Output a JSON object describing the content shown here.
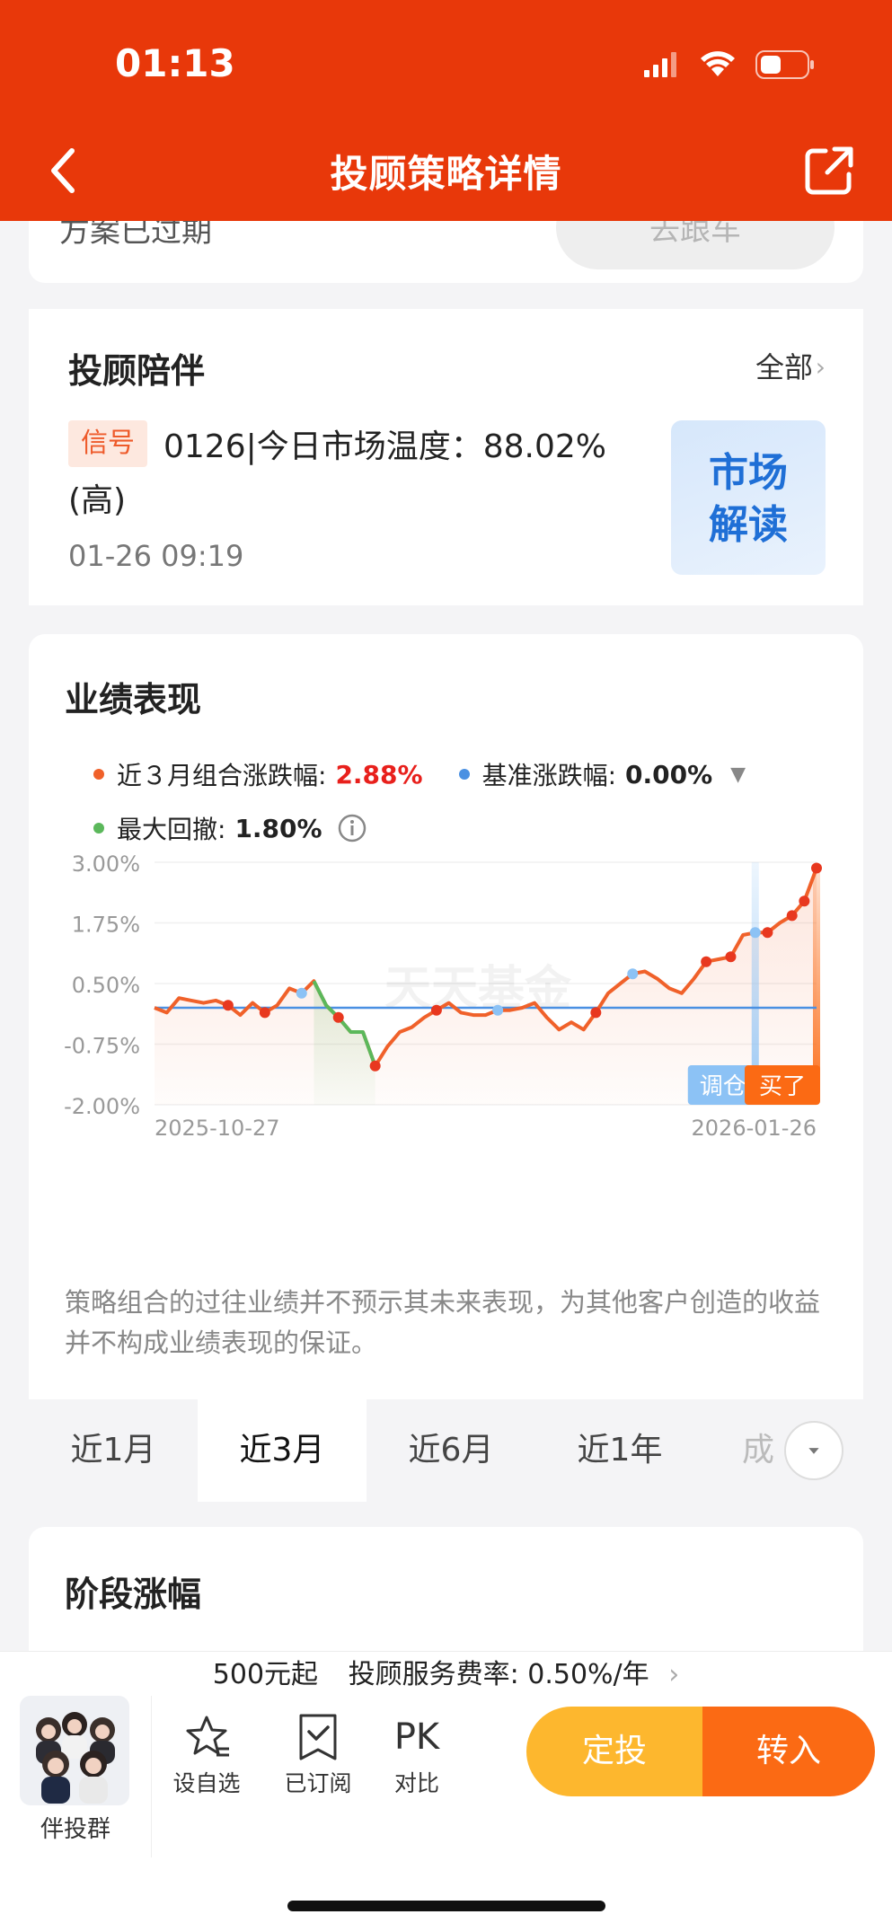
{
  "status_bar": {
    "time": "01:13"
  },
  "nav": {
    "title": "投顾策略详情"
  },
  "expired": {
    "text": "方案已过期",
    "follow_button": "去跟车"
  },
  "advisor": {
    "title": "投顾陪伴",
    "all_link": "全部",
    "signal_tag": "信号",
    "signal_text": "0126|今日市场温度：88.02%(高)",
    "signal_time": "01-26 09:19",
    "market_tile_line1": "市场",
    "market_tile_line2": "解读"
  },
  "performance": {
    "title": "业绩表现",
    "legend_portfolio_label": "近３月组合涨跌幅:",
    "legend_portfolio_value": "2.88%",
    "legend_benchmark_label": "基准涨跌幅:",
    "legend_benchmark_value": "0.00%",
    "legend_drawdown_label": "最大回撤:",
    "legend_drawdown_value": "1.80%",
    "watermark": "天天基金",
    "tag_adjust": "调仓",
    "tag_buy": "买了",
    "disclaimer": "策略组合的过往业绩并不预示其未来表现，为其他客户创造的收益并不构成业绩表现的保证。",
    "colors": {
      "portfolio": "#f0612a",
      "benchmark": "#4a90e2",
      "drawdown": "#5bb85b",
      "positive": "#e8201c"
    }
  },
  "chart_data": {
    "type": "line",
    "x_start": "2025-10-27",
    "x_end": "2026-01-26",
    "ylim": [
      -2.0,
      3.0
    ],
    "yticks": [
      "3.00%",
      "1.75%",
      "0.50%",
      "-0.75%",
      "-2.00%"
    ],
    "xticks": [
      "2025-10-27",
      "2026-01-26"
    ],
    "series": [
      {
        "values": [
          0.0,
          -0.1,
          0.2,
          0.15,
          0.1,
          0.15,
          0.05,
          -0.15,
          0.1,
          -0.1,
          0.05,
          0.4,
          0.3,
          0.55,
          0.05,
          -0.2,
          -0.5,
          -0.5,
          -1.2,
          -0.8,
          -0.5,
          -0.4,
          -0.2,
          -0.05,
          0.1,
          -0.1,
          -0.15,
          -0.15,
          -0.05,
          -0.05,
          0.0,
          0.1,
          -0.2,
          -0.45,
          -0.3,
          -0.45,
          -0.1,
          0.3,
          0.5,
          0.7,
          0.75,
          0.6,
          0.4,
          0.3,
          0.6,
          0.95,
          1.0,
          1.05,
          1.5,
          1.55,
          1.55,
          1.75,
          1.9,
          2.2,
          2.88
        ]
      },
      {
        "values": [
          0.0,
          0.0,
          0.0,
          0.0,
          0.0,
          0.0,
          0.0,
          0.0,
          0.0,
          0.0,
          0.0,
          0.0,
          0.0,
          0.0,
          0.0,
          0.0,
          0.0,
          0.0,
          0.0,
          0.0,
          0.0,
          0.0,
          0.0,
          0.0,
          0.0,
          0.0,
          0.0,
          0.0,
          0.0,
          0.0,
          0.0,
          0.0,
          0.0,
          0.0,
          0.0,
          0.0,
          0.0,
          0.0,
          0.0,
          0.0,
          0.0,
          0.0,
          0.0,
          0.0,
          0.0,
          0.0,
          0.0,
          0.0,
          0.0,
          0.0,
          0.0,
          0.0,
          0.0,
          0.0,
          0.0
        ]
      }
    ],
    "drawdown_range": [
      13,
      18
    ],
    "events": {
      "adjust_index": 49,
      "buy_index": 54
    }
  },
  "tabs": {
    "items": [
      {
        "label": "近1月"
      },
      {
        "label": "近3月"
      },
      {
        "label": "近6月"
      },
      {
        "label": "近1年"
      },
      {
        "label": "成"
      }
    ]
  },
  "stage": {
    "title": "阶段涨幅"
  },
  "bottom": {
    "fee_prefix": "500元起",
    "fee_text": "投顾服务费率: 0.50%/年",
    "group_label": "伴投群",
    "watchlist": "设自选",
    "subscribed": "已订阅",
    "pk_icon": "PK",
    "compare": "对比",
    "sip_button": "定投",
    "buy_button": "转入"
  }
}
